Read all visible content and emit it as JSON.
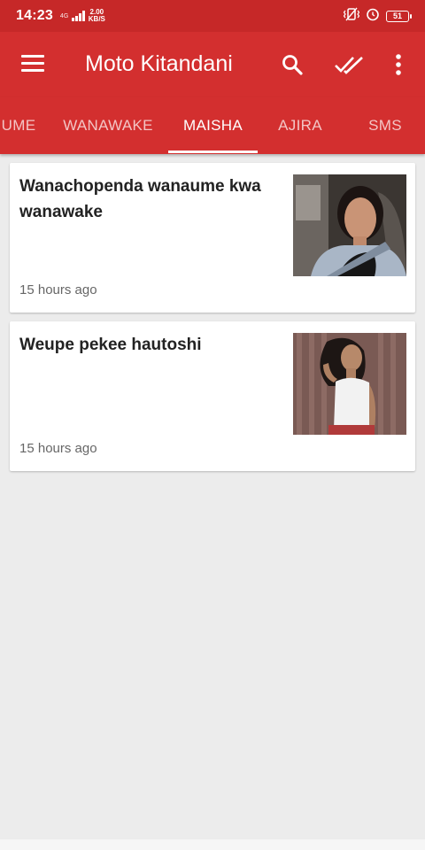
{
  "status_bar": {
    "time": "14:23",
    "network_type": "4G",
    "speed_value": "2.00",
    "speed_unit": "KB/S",
    "battery_level": "51"
  },
  "app_bar": {
    "title": "Moto Kitandani",
    "menu_icon": "hamburger-menu-icon",
    "actions": [
      {
        "icon": "search-icon"
      },
      {
        "icon": "double-check-icon"
      },
      {
        "icon": "more-vert-icon"
      }
    ]
  },
  "tabs": [
    {
      "label": "UME",
      "active": false
    },
    {
      "label": "WANAWAKE",
      "active": false
    },
    {
      "label": "MAISHA",
      "active": true
    },
    {
      "label": "AJIRA",
      "active": false
    },
    {
      "label": "SMS",
      "active": false
    }
  ],
  "articles": [
    {
      "headline": "Wanachopenda wanaume kwa wanawake",
      "time": "15 hours ago",
      "thumbnail": "woman-selfie-in-car-photo"
    },
    {
      "headline": "Weupe pekee hautoshi",
      "time": "15 hours ago",
      "thumbnail": "woman-white-top-photo"
    }
  ],
  "colors": {
    "status_bar": "#c62828",
    "app_bar": "#d32f2f",
    "background": "#ececec"
  }
}
